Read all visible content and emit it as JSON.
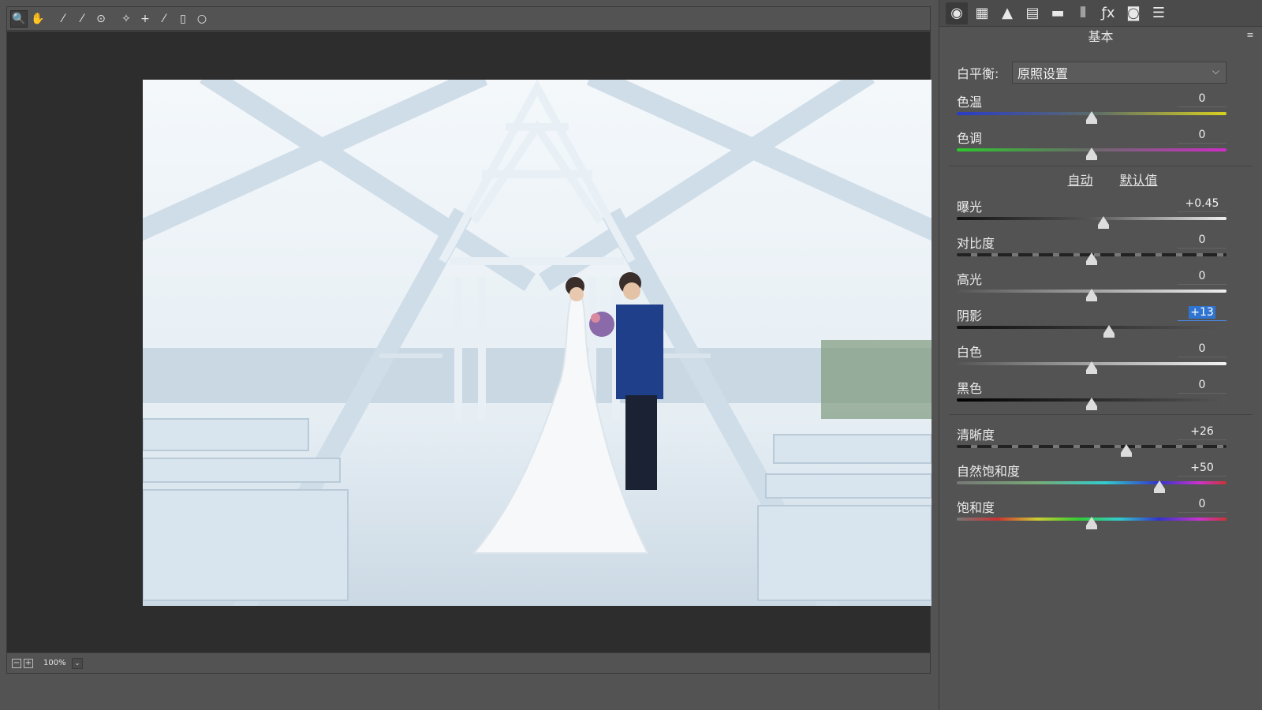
{
  "toolbar": {
    "tools": [
      {
        "name": "zoom-tool-icon",
        "glyph": "🔍",
        "active": true
      },
      {
        "name": "hand-tool-icon",
        "glyph": "✋",
        "active": false
      },
      {
        "name": "white-balance-tool-icon",
        "glyph": "⁄",
        "active": false
      },
      {
        "name": "color-sampler-tool-icon",
        "glyph": "⁄",
        "active": false
      },
      {
        "name": "targeted-adjustment-tool-icon",
        "glyph": "⊙",
        "active": false
      },
      {
        "name": "spot-removal-tool-icon",
        "glyph": "✧",
        "active": false
      },
      {
        "name": "red-eye-tool-icon",
        "glyph": "+",
        "active": false
      },
      {
        "name": "adjustment-brush-icon",
        "glyph": "⁄",
        "active": false
      },
      {
        "name": "graduated-filter-icon",
        "glyph": "▯",
        "active": false
      },
      {
        "name": "radial-filter-icon",
        "glyph": "○",
        "active": false
      }
    ]
  },
  "status": {
    "zoom_out": "−",
    "zoom_in": "+",
    "zoom_level": "100%"
  },
  "panel": {
    "tabs": [
      "basic-tab-icon",
      "tone-curve-tab-icon",
      "detail-tab-icon",
      "hsl-tab-icon",
      "split-toning-tab-icon",
      "lens-corrections-tab-icon",
      "effects-tab-icon",
      "camera-calibration-tab-icon",
      "presets-tab-icon"
    ],
    "title": "基本",
    "white_balance": {
      "label": "白平衡:",
      "value": "原照设置"
    },
    "sliders_wb": [
      {
        "key": "temp",
        "label": "色温",
        "value": "0",
        "pos": 0.5,
        "track": "linear-gradient(90deg,#2a3cc8,#5a6a6a 50%,#d8d020)"
      },
      {
        "key": "tint",
        "label": "色调",
        "value": "0",
        "pos": 0.5,
        "track": "linear-gradient(90deg,#2cc82c,#6a6a6a 50%,#d02cc8)"
      }
    ],
    "links": {
      "auto": "自动",
      "default": "默认值"
    },
    "sliders_tone": [
      {
        "key": "exposure",
        "label": "曝光",
        "value": "+0.45",
        "pos": 0.545,
        "track": "linear-gradient(90deg,#111,#555 50%,#eee)"
      },
      {
        "key": "contrast",
        "label": "对比度",
        "value": "0",
        "pos": 0.5,
        "track": "repeating-linear-gradient(90deg,#222 0 18px,#777 18px 26px)"
      },
      {
        "key": "highlights",
        "label": "高光",
        "value": "0",
        "pos": 0.5,
        "track": "linear-gradient(90deg,#555,#eee)"
      },
      {
        "key": "shadows",
        "label": "阴影",
        "value": "+13",
        "pos": 0.565,
        "selected": true,
        "track": "linear-gradient(90deg,#111,#555)"
      },
      {
        "key": "whites",
        "label": "白色",
        "value": "0",
        "pos": 0.5,
        "track": "linear-gradient(90deg,#555,#f4f4f4)"
      },
      {
        "key": "blacks",
        "label": "黑色",
        "value": "0",
        "pos": 0.5,
        "track": "linear-gradient(90deg,#000,#555)"
      }
    ],
    "sliders_presence": [
      {
        "key": "clarity",
        "label": "清晰度",
        "value": "+26",
        "pos": 0.63,
        "track": "repeating-linear-gradient(90deg,#222 0 18px,#777 18px 26px)"
      },
      {
        "key": "vibrance",
        "label": "自然饱和度",
        "value": "+50",
        "pos": 0.75,
        "track": "linear-gradient(90deg,#777,#7a7 30%,#3cc 55%,#33c 75%,#c3c 90%,#c33)"
      },
      {
        "key": "saturation",
        "label": "饱和度",
        "value": "0",
        "pos": 0.5,
        "track": "linear-gradient(90deg,#777,#c33 15%,#cc3 30%,#3c3 45%,#3cc 60%,#33c 75%,#c3c 90%,#c33)"
      }
    ]
  }
}
